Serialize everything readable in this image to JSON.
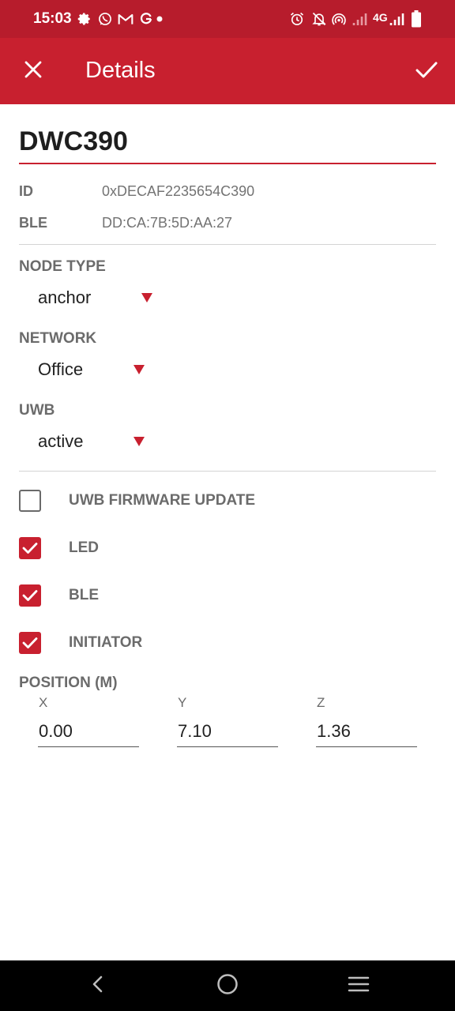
{
  "status_bar": {
    "time": "15:03",
    "network": "4G",
    "icons": [
      "gear-icon",
      "whatsapp-icon",
      "gmail-icon",
      "google-icon",
      "dot-icon",
      "alarm-icon",
      "bell-off-icon",
      "hotspot-icon",
      "signal-icon",
      "signal-icon",
      "battery-icon"
    ]
  },
  "app_bar": {
    "title": "Details",
    "close_icon": "close-icon",
    "confirm_icon": "check-icon"
  },
  "device": {
    "name": "DWC390",
    "id_label": "ID",
    "id_value": "0xDECAF2235654C390",
    "ble_label": "BLE",
    "ble_value": "DD:CA:7B:5D:AA:27"
  },
  "node_type": {
    "label": "NODE TYPE",
    "value": "anchor"
  },
  "network": {
    "label": "NETWORK",
    "value": "Office"
  },
  "uwb": {
    "label": "UWB",
    "value": "active"
  },
  "checkboxes": [
    {
      "label": "UWB FIRMWARE UPDATE",
      "checked": false
    },
    {
      "label": "LED",
      "checked": true
    },
    {
      "label": "BLE",
      "checked": true
    },
    {
      "label": "INITIATOR",
      "checked": true
    }
  ],
  "position": {
    "label": "POSITION (M)",
    "x_label": "X",
    "x_value": "0.00",
    "y_label": "Y",
    "y_value": "7.10",
    "z_label": "Z",
    "z_value": "1.36"
  },
  "nav_bar": {
    "icons": [
      "back-icon",
      "home-icon",
      "menu-icon"
    ]
  },
  "colors": {
    "accent": "#c8202f",
    "status_bar": "#b71c2c",
    "nav_bar": "#000000"
  }
}
